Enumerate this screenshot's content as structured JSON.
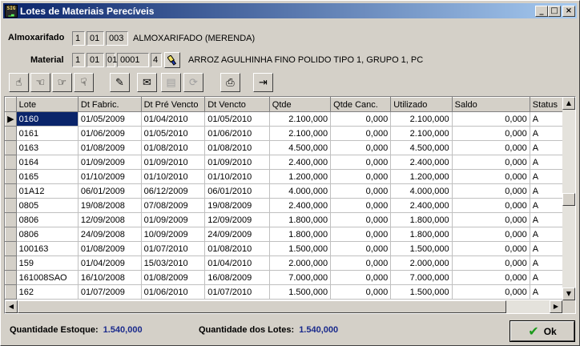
{
  "window": {
    "title": "Lotes de Materiais Perecíveis",
    "controls": {
      "minimize": "_",
      "maximize": "□",
      "close": "×"
    }
  },
  "almoxarifado": {
    "label": "Almoxarifado",
    "codes": [
      "1",
      "01",
      "003"
    ],
    "name": "ALMOXARIFADO (MERENDA)"
  },
  "material": {
    "label": "Material",
    "codes": [
      "1",
      "01",
      "01",
      "0001",
      "4"
    ],
    "name": "ARROZ AGULHINHA FINO POLIDO TIPO 1, GRUPO 1, PC"
  },
  "toolbar": [
    {
      "icon": "hand-point-up-icon",
      "glyph": "☝",
      "enabled": true
    },
    {
      "icon": "hand-point-left-icon",
      "glyph": "☜",
      "enabled": true
    },
    {
      "icon": "hand-point-right-icon",
      "glyph": "☞",
      "enabled": true
    },
    {
      "icon": "hand-point-down-icon",
      "glyph": "☟",
      "enabled": true
    },
    {
      "icon": "document-edit-icon",
      "glyph": "✎",
      "enabled": true
    },
    {
      "icon": "envelope-icon",
      "glyph": "✉",
      "enabled": true
    },
    {
      "icon": "document-disabled-icon",
      "glyph": "▤",
      "enabled": false
    },
    {
      "icon": "refresh-disabled-icon",
      "glyph": "⟳",
      "enabled": false
    },
    {
      "icon": "printer-icon",
      "glyph": "⎙",
      "enabled": true
    },
    {
      "icon": "exit-icon",
      "glyph": "⇥",
      "enabled": true
    }
  ],
  "grid": {
    "columns": [
      "Lote",
      "Dt Fabric.",
      "Dt Pré Vencto",
      "Dt Vencto",
      "Qtde",
      "Qtde Canc.",
      "Utilizado",
      "Saldo",
      "Status"
    ],
    "rows": [
      [
        "0160",
        "01/05/2009",
        "01/04/2010",
        "01/05/2010",
        "2.100,000",
        "0,000",
        "2.100,000",
        "0,000",
        "A"
      ],
      [
        "0161",
        "01/06/2009",
        "01/05/2010",
        "01/06/2010",
        "2.100,000",
        "0,000",
        "2.100,000",
        "0,000",
        "A"
      ],
      [
        "0163",
        "01/08/2009",
        "01/08/2010",
        "01/08/2010",
        "4.500,000",
        "0,000",
        "4.500,000",
        "0,000",
        "A"
      ],
      [
        "0164",
        "01/09/2009",
        "01/09/2010",
        "01/09/2010",
        "2.400,000",
        "0,000",
        "2.400,000",
        "0,000",
        "A"
      ],
      [
        "0165",
        "01/10/2009",
        "01/10/2010",
        "01/10/2010",
        "1.200,000",
        "0,000",
        "1.200,000",
        "0,000",
        "A"
      ],
      [
        "01A12",
        "06/01/2009",
        "06/12/2009",
        "06/01/2010",
        "4.000,000",
        "0,000",
        "4.000,000",
        "0,000",
        "A"
      ],
      [
        "0805",
        "19/08/2008",
        "07/08/2009",
        "19/08/2009",
        "2.400,000",
        "0,000",
        "2.400,000",
        "0,000",
        "A"
      ],
      [
        "0806",
        "12/09/2008",
        "01/09/2009",
        "12/09/2009",
        "1.800,000",
        "0,000",
        "1.800,000",
        "0,000",
        "A"
      ],
      [
        "0806",
        "24/09/2008",
        "10/09/2009",
        "24/09/2009",
        "1.800,000",
        "0,000",
        "1.800,000",
        "0,000",
        "A"
      ],
      [
        "100163",
        "01/08/2009",
        "01/07/2010",
        "01/08/2010",
        "1.500,000",
        "0,000",
        "1.500,000",
        "0,000",
        "A"
      ],
      [
        "159",
        "01/04/2009",
        "15/03/2010",
        "01/04/2010",
        "2.000,000",
        "0,000",
        "2.000,000",
        "0,000",
        "A"
      ],
      [
        "161008SAO",
        "16/10/2008",
        "01/08/2009",
        "16/08/2009",
        "7.000,000",
        "0,000",
        "7.000,000",
        "0,000",
        "A"
      ],
      [
        "162",
        "01/07/2009",
        "01/06/2010",
        "01/07/2010",
        "1.500,000",
        "0,000",
        "1.500,000",
        "0,000",
        "A"
      ]
    ],
    "selected_row_indicator": "▶"
  },
  "footer": {
    "estoque_label": "Quantidade Estoque:",
    "estoque_value": "1.540,000",
    "lotes_label": "Quantidade dos Lotes:",
    "lotes_value": "1.540,000",
    "ok_label": "Ok"
  }
}
